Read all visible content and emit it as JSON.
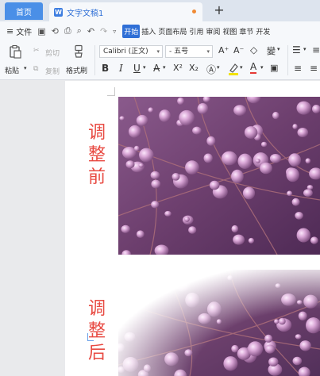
{
  "titlebar": {
    "home_tab": "首页",
    "doc_tab": "文字文稿1",
    "new_tab_symbol": "+"
  },
  "menubar": {
    "file_label": "文件",
    "tabs": [
      "开始",
      "插入",
      "页面布局",
      "引用",
      "审阅",
      "视图",
      "章节",
      "开发"
    ]
  },
  "ribbon": {
    "paste_label": "粘贴",
    "cut_label": "剪切",
    "copy_label": "复制",
    "format_painter_label": "格式刷",
    "font_name": "Calibri (正文)",
    "font_size": "五号",
    "bold": "B",
    "italic": "I",
    "underline": "U",
    "font_color_a": "A",
    "superscript": "X²",
    "subscript": "X₂",
    "grow_font": "A⁺",
    "shrink_font": "A⁻",
    "clear_format": "◇",
    "pinyin": "變"
  },
  "document": {
    "label_before": [
      "调",
      "整",
      "前"
    ],
    "label_after": [
      "调",
      "整",
      "后"
    ]
  },
  "colors": {
    "accent": "#2f6fd6",
    "home_tab": "#4a8fe7",
    "label_red": "#e84a42",
    "photo_purple": "#7a4a7e"
  }
}
